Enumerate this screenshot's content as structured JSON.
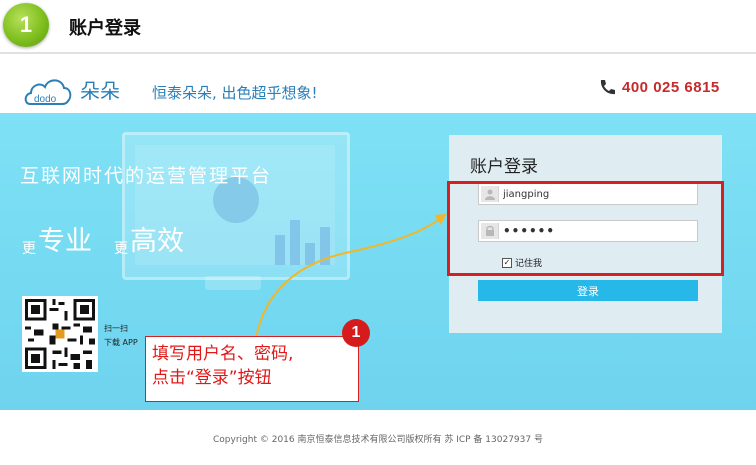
{
  "step": {
    "number": "1",
    "title": "账户登录"
  },
  "header": {
    "logo_text": "dodo",
    "brand": "朵朵",
    "slogan": "恒泰朵朵, 出色超乎想象!",
    "phone_icon": "phone-icon",
    "hotline": "400 025 6815"
  },
  "hero": {
    "title": "互联网时代的运营管理平台",
    "sub": [
      {
        "small": "更",
        "large": "专业"
      },
      {
        "small": "更",
        "large": "高效"
      }
    ],
    "qr_line1": "扫一扫",
    "qr_line2": "下载 APP"
  },
  "login": {
    "title": "账户登录",
    "username": "jiangping",
    "password": "••••••",
    "remember_label": "记住我",
    "remember_checked": true,
    "submit_label": "登录"
  },
  "annotation": {
    "badge": "1",
    "line1": "填写用户名、密码,",
    "line2": "点击“登录”按钮",
    "color": "#d42020"
  },
  "footer": {
    "copyright": "Copyright © 2016 南京恒泰信息技术有限公司版权所有  苏 ICP 备 13027937 号"
  },
  "colors": {
    "accent": "#27b8ea",
    "hero_bg": "#7fe1f5",
    "brand_blue": "#2a7fb8",
    "hotline_red": "#c62a2a",
    "badge_green": "#7fbf1f"
  }
}
